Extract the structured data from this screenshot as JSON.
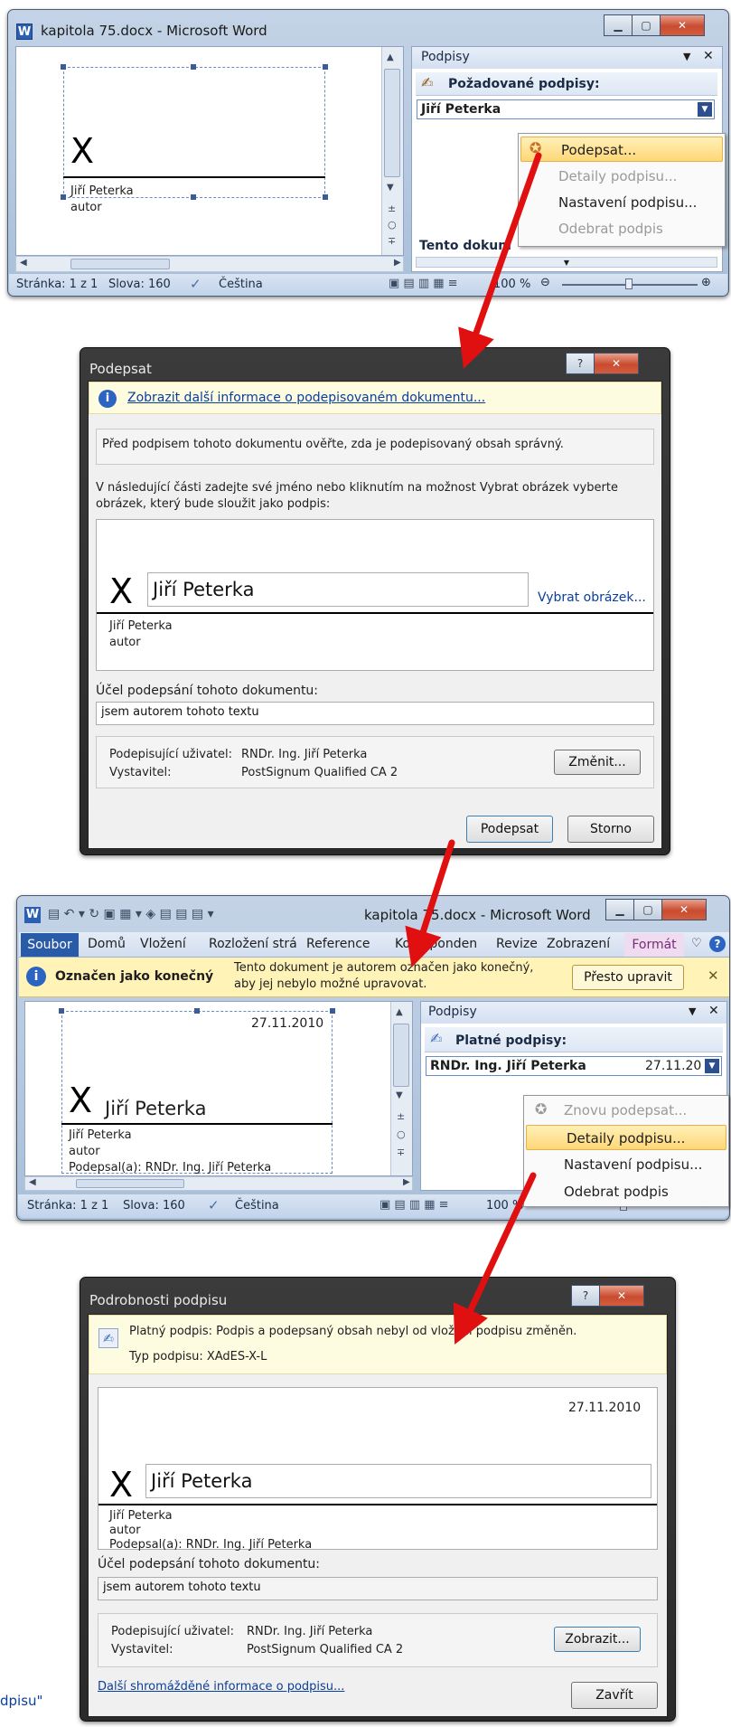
{
  "word1": {
    "title": "kapitola 75.docx - Microsoft Word",
    "app_icon": "W",
    "sig_x": "X",
    "signer_name": "Jiří Peterka",
    "signer_title": "autor",
    "pane_title": "Podpisy",
    "required_label": "Požadované podpisy:",
    "list_item": "Jiří Peterka",
    "pane_bottom_text": "Tento dokum",
    "menu": [
      "Podepsat...",
      "Detaily podpisu...",
      "Nastavení podpisu...",
      "Odebrat podpis"
    ],
    "status": {
      "page": "Stránka: 1 z 1",
      "words": "Slova: 160",
      "lang": "Čeština",
      "zoom": "100 %"
    }
  },
  "sign_dialog": {
    "title": "Podepsat",
    "help": "?",
    "info_link": "Zobrazit další informace o podepisovaném dokumentu...",
    "warning": "Před podpisem tohoto dokumentu ověřte, zda je podepisovaný obsah správný.",
    "instruction_1": "V následující části zadejte své jméno nebo kliknutím na možnost Vybrat obrázek vyberte",
    "instruction_2": "obrázek, který bude sloužit jako podpis:",
    "sig_x": "X",
    "name_value": "Jiří Peterka",
    "choose_image": "Vybrat obrázek...",
    "signer_name": "Jiří Peterka",
    "signer_title": "autor",
    "purpose_label": "Účel podepsání tohoto dokumentu:",
    "purpose_value": "jsem autorem tohoto textu",
    "signing_user_label": "Podepisující uživatel:",
    "signing_user_value": "RNDr. Ing. Jiří Peterka",
    "issuer_label": "Vystavitel:",
    "issuer_value": "PostSignum Qualified CA 2",
    "change_btn": "Změnit...",
    "sign_btn": "Podepsat",
    "cancel_btn": "Storno"
  },
  "word2": {
    "title": "kapitola 75.docx - Microsoft Word",
    "tabs": [
      "Soubor",
      "Domů",
      "Vložení",
      "Rozložení strá",
      "Reference",
      "Koresponden",
      "Revize",
      "Zobrazení",
      "Formát"
    ],
    "final_label": "Označen jako konečný",
    "final_msg_1": "Tento dokument je autorem označen jako konečný,",
    "final_msg_2": "aby jej nebylo možné upravovat.",
    "edit_anyway": "Přesto upravit",
    "date": "27.11.2010",
    "sig_x": "X",
    "sig_name": "Jiří Peterka",
    "signer_name": "Jiří Peterka",
    "signer_title": "autor",
    "signed_by": "Podepsal(a): RNDr. Ing. Jiří Peterka",
    "pane_title": "Podpisy",
    "valid_label": "Platné podpisy:",
    "list_name": "RNDr. Ing. Jiří Peterka",
    "list_date": "27.11.20",
    "menu": [
      "Znovu podepsat...",
      "Detaily podpisu...",
      "Nastavení podpisu...",
      "Odebrat podpis"
    ],
    "status": {
      "page": "Stránka: 1 z 1",
      "words": "Slova: 160",
      "lang": "Čeština",
      "zoom": "100 %"
    }
  },
  "details_dialog": {
    "title": "Podrobnosti podpisu",
    "help": "?",
    "valid_msg": "Platný podpis: Podpis a podepsaný obsah nebyl od vložení podpisu změněn.",
    "type": "Typ podpisu: XAdES-X-L",
    "date": "27.11.2010",
    "sig_x": "X",
    "name_value": "Jiří Peterka",
    "signer_name": "Jiří Peterka",
    "signer_title": "autor",
    "signed_by": "Podepsal(a): RNDr. Ing. Jiří Peterka",
    "purpose_label": "Účel podepsání tohoto dokumentu:",
    "purpose_value": "jsem autorem tohoto textu",
    "signing_user_label": "Podepisující uživatel:",
    "signing_user_value": "RNDr. Ing. Jiří Peterka",
    "issuer_label": "Vystavitel:",
    "issuer_value": "PostSignum Qualified CA 2",
    "show_btn": "Zobrazit...",
    "more_link": "Další shromážděné informace o podpisu...",
    "close_btn": "Zavřít"
  },
  "caption_fragment": "dpisu\"",
  "colors": {
    "arrow": "#e01010",
    "link": "#0a3e9d",
    "soubor": "#2a5ba8"
  }
}
